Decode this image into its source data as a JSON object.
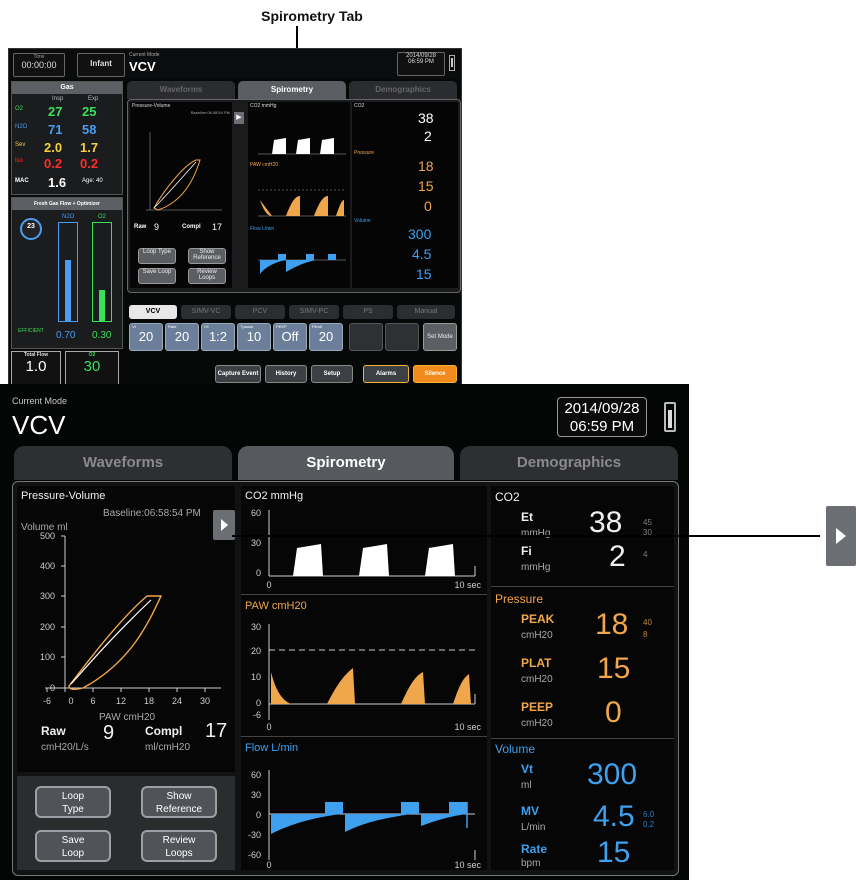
{
  "caption": "Spirometry Tab",
  "thumb": {
    "time": "00:00:00",
    "time_label": "Time",
    "patient": "Infant",
    "current_mode_label": "Current Mode",
    "mode": "VCV",
    "date": "2014/09/28",
    "time_of_day": "06:59 PM",
    "tabs": [
      "Waveforms",
      "Spirometry",
      "Demographics"
    ],
    "gas": {
      "title": "Gas",
      "insp_label": "Insp",
      "exp_label": "Exp",
      "rows": [
        {
          "name": "O2",
          "insp": "27",
          "exp": "25"
        },
        {
          "name": "N2O",
          "insp": "71",
          "exp": "58"
        },
        {
          "name": "Sev",
          "insp": "2.0",
          "exp": "1.7"
        },
        {
          "name": "Iso",
          "insp": "0.2",
          "exp": "0.2"
        }
      ],
      "mac_label": "MAC",
      "mac": "1.6",
      "age_label": "Age: 40"
    },
    "fresh_gas_title": "Fresh Gas Flow + Optimizer",
    "fgf_n2o_label": "N2O",
    "fgf_o2_label": "O2",
    "fgf_n2o_value": "0.70",
    "fgf_o2_value": "0.30",
    "fgf_efficient": "EFFICIENT",
    "fgf_gauge_value": "23",
    "total_flow_label": "Total Flow",
    "total_flow": "1.0",
    "o2_percent_label": "O2",
    "o2_percent": "30",
    "pv_title": "Pressure-Volume",
    "pv_baseline": "Baseline:06:58:54 PM",
    "raw_label": "Raw",
    "raw": "9",
    "compl_label": "Compl",
    "compl": "17",
    "buttons": [
      "Loop Type",
      "Show Reference",
      "Save Loop",
      "Review Loops"
    ],
    "co2_label": "CO2 mmHg",
    "paw_label": "PAW cmH20",
    "flow_label": "Flow L/min",
    "right": {
      "co2": "CO2",
      "et": "38",
      "fi": "2",
      "pressure": "Pressure",
      "peak": "18",
      "plat": "15",
      "peep": "0",
      "volume": "Volume",
      "vt": "300",
      "mv": "4.5",
      "rate": "15"
    },
    "modes": [
      "VCV",
      "SIMV-VC",
      "PCV",
      "SIMV-PC",
      "PS",
      "Manual"
    ],
    "params": [
      {
        "label": "Vt",
        "value": "20"
      },
      {
        "label": "Rate",
        "value": "20"
      },
      {
        "label": "I:E",
        "value": "1:2"
      },
      {
        "label": "Tpause",
        "value": "10"
      },
      {
        "label": "PEEP",
        "value": "Off"
      },
      {
        "label": "Plimit",
        "value": "20"
      }
    ],
    "set_mode": "Set Mode",
    "bottom_buttons": [
      "Capture Event",
      "History",
      "Setup",
      "Alarms",
      "Silence"
    ]
  },
  "big": {
    "current_mode_label": "Current Mode",
    "mode": "VCV",
    "date": "2014/09/28",
    "time": "06:59 PM",
    "tabs": [
      "Waveforms",
      "Spirometry",
      "Demographics"
    ],
    "pv": {
      "title": "Pressure-Volume",
      "baseline": "Baseline:06:58:54 PM",
      "y_axis_label": "Volume ml",
      "x_axis_label": "PAW cmH20",
      "y_ticks": [
        "500",
        "400",
        "300",
        "200",
        "100",
        "0"
      ],
      "x_ticks": [
        "-6",
        "0",
        "6",
        "12",
        "18",
        "24",
        "30"
      ],
      "raw_label": "Raw",
      "raw_unit": "cmH20/L/s",
      "raw_value": "9",
      "compl_label": "Compl",
      "compl_unit": "ml/cmH20",
      "compl_value": "17"
    },
    "buttons": [
      {
        "line1": "Loop",
        "line2": "Type"
      },
      {
        "line1": "Show",
        "line2": "Reference"
      },
      {
        "line1": "Save",
        "line2": "Loop"
      },
      {
        "line1": "Review",
        "line2": "Loops"
      }
    ],
    "waves": {
      "co2": {
        "title": "CO2 mmHg",
        "ticks": [
          "60",
          "30",
          "0"
        ],
        "x0": "0",
        "x1": "10 sec"
      },
      "paw": {
        "title": "PAW cmH20",
        "ticks": [
          "30",
          "20",
          "10",
          "0",
          "-6"
        ],
        "x0": "0",
        "x1": "10 sec"
      },
      "flow": {
        "title": "Flow L/min",
        "ticks": [
          "60",
          "30",
          "0",
          "-30",
          "-60"
        ],
        "x0": "0",
        "x1": "10 sec"
      }
    },
    "numerics": {
      "co2_header": "CO2",
      "et_label": "Et",
      "et_unit": "mmHg",
      "et_value": "38",
      "et_hi": "45",
      "et_lo": "30",
      "fi_label": "Fi",
      "fi_unit": "mmHg",
      "fi_value": "2",
      "fi_hi": "4",
      "pressure_header": "Pressure",
      "peak_label": "PEAK",
      "peak_unit": "cmH20",
      "peak_value": "18",
      "peak_hi": "40",
      "peak_lo": "8",
      "plat_label": "PLAT",
      "plat_unit": "cmH20",
      "plat_value": "15",
      "peep_label": "PEEP",
      "peep_unit": "cmH20",
      "peep_value": "0",
      "volume_header": "Volume",
      "vt_label": "Vt",
      "vt_unit": "ml",
      "vt_value": "300",
      "mv_label": "MV",
      "mv_unit": "L/min",
      "mv_value": "4.5",
      "mv_hi": "6.0",
      "mv_lo": "0.2",
      "rate_label": "Rate",
      "rate_unit": "bpm",
      "rate_value": "15"
    }
  },
  "colors": {
    "orange": "#f0a64a",
    "blue": "#3ea0ee",
    "green": "#39e05a",
    "red": "#ff2b2b",
    "alarm_yellow": "#f3b431",
    "silence_orange": "#f08a1c"
  }
}
